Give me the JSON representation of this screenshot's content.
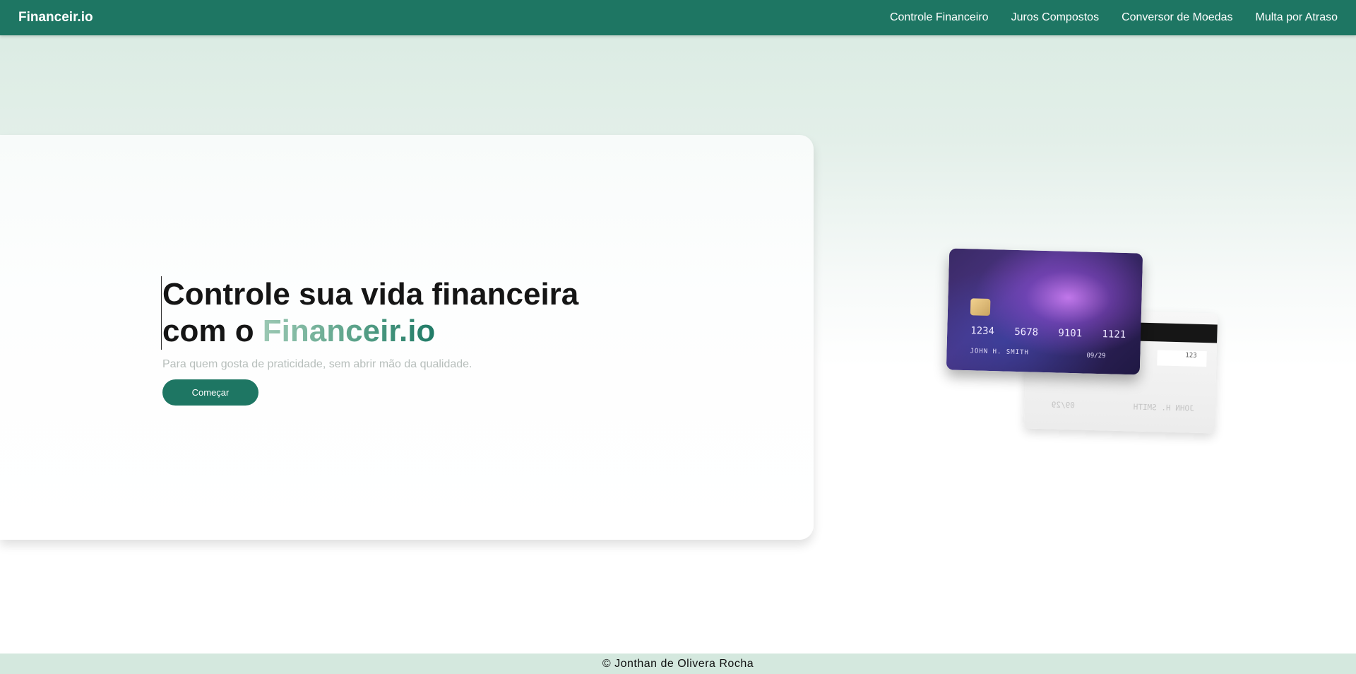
{
  "nav": {
    "brand": "Financeir.io",
    "links": [
      {
        "label": "Controle Financeiro"
      },
      {
        "label": "Juros Compostos"
      },
      {
        "label": "Conversor de Moedas"
      },
      {
        "label": "Multa por Atraso"
      }
    ]
  },
  "hero": {
    "headline_part1": "Controle sua vida financeira",
    "headline_part2": "com o ",
    "headline_accent": "Financeir.io",
    "subtitle": "Para quem gosta de praticidade, sem abrir mão da qualidade.",
    "cta_label": "Começar"
  },
  "illustration": {
    "card_number_groups": [
      "1234",
      "5678",
      "9101",
      "1121"
    ],
    "card_holder": "JOHN H. SMITH",
    "card_expiry": "09/29",
    "card_cvv": "123",
    "back_left_text": "09/29",
    "back_right_text": "JOHN H. SMITH"
  },
  "footer": {
    "text": "© Jonthan de Olivera Rocha"
  },
  "colors": {
    "primary": "#1e7663",
    "footer_bg": "#d4e8de",
    "subtitle": "#b7bebb"
  }
}
